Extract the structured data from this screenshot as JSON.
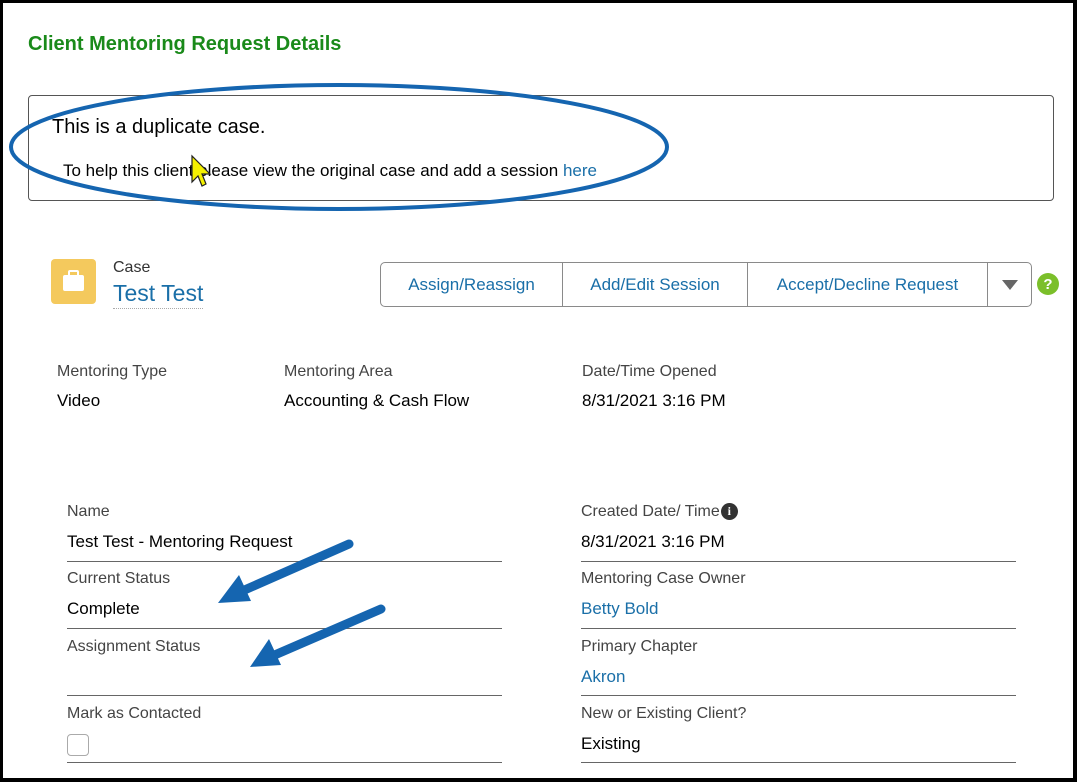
{
  "page": {
    "title": "Client Mentoring Request Details"
  },
  "duplicate_notice": {
    "heading": "This is a duplicate case.",
    "message": "To help this client please view the original case and add a session",
    "link_text": "here"
  },
  "case_header": {
    "icon": "briefcase-icon",
    "label": "Case",
    "name": "Test Test",
    "actions": [
      "Assign/Reassign",
      "Add/Edit Session",
      "Accept/Decline Request"
    ],
    "more_icon": "triangle-down-icon",
    "help_icon": "question-icon"
  },
  "highlights": [
    {
      "label": "Mentoring Type",
      "value": "Video"
    },
    {
      "label": "Mentoring Area",
      "value": "Accounting & Cash Flow"
    },
    {
      "label": "Date/Time Opened",
      "value": "8/31/2021 3:16 PM"
    }
  ],
  "fields_left": [
    {
      "label": "Name",
      "value": "Test Test - Mentoring Request"
    },
    {
      "label": "Current Status",
      "value": "Complete"
    },
    {
      "label": "Assignment Status",
      "value": ""
    },
    {
      "label": "Mark as Contacted",
      "value": ""
    }
  ],
  "fields_right": [
    {
      "label": "Created Date/ Time",
      "value": "8/31/2021 3:16 PM"
    },
    {
      "label": "Mentoring Case Owner",
      "value": "Betty Bold"
    },
    {
      "label": "Primary Chapter",
      "value": "Akron"
    },
    {
      "label": "New or Existing Client?",
      "value": "Existing"
    }
  ],
  "colors": {
    "title_green": "#1a8a1a",
    "link_blue": "#1a6fa8",
    "case_icon_yellow": "#f4c95d",
    "annotation_blue": "#1565b0",
    "help_green": "#7bbf2a"
  }
}
